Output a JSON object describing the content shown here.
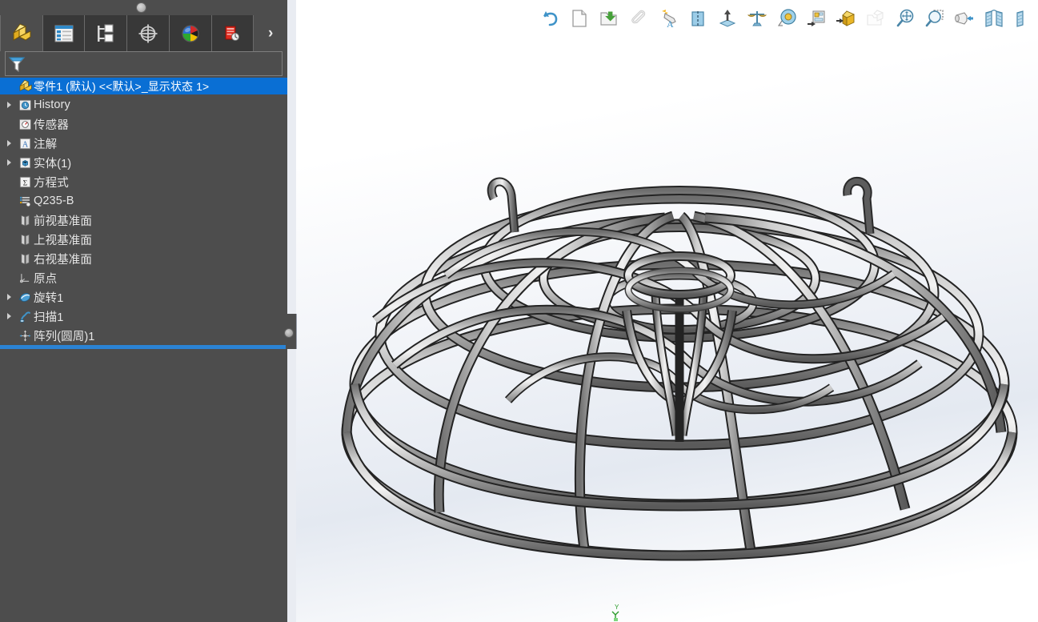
{
  "panel": {
    "grip_name": "panel-splitter-handle",
    "tabs": [
      {
        "id": "feature-manager",
        "label": "FeatureManager 设计树",
        "icon": "yellow-feature-tree-icon",
        "active": true
      },
      {
        "id": "property-manager",
        "label": "PropertyManager",
        "icon": "property-list-icon",
        "active": false
      },
      {
        "id": "configuration-manager",
        "label": "ConfigurationManager",
        "icon": "configuration-tree-icon",
        "active": false
      },
      {
        "id": "dimxpert-manager",
        "label": "DimXpertManager",
        "icon": "dimxpert-target-icon",
        "active": false
      },
      {
        "id": "display-manager",
        "label": "DisplayManager",
        "icon": "display-sphere-icon",
        "active": false
      },
      {
        "id": "appearance-manager",
        "label": "外观",
        "icon": "red-appearance-icon",
        "active": false
      }
    ],
    "expander_glyph": "›",
    "filter": {
      "placeholder": "",
      "value": "",
      "icon": "filter-funnel-icon"
    }
  },
  "tree": {
    "root": {
      "label": "零件1 (默认) <<默认>_显示状态 1>",
      "icon": "part-yellow-icon",
      "selected": true
    },
    "items": [
      {
        "label": "History",
        "icon": "history-icon",
        "expandable": true
      },
      {
        "label": "传感器",
        "icon": "sensor-icon",
        "expandable": false
      },
      {
        "label": "注解",
        "icon": "annotation-icon",
        "expandable": true
      },
      {
        "label": "实体(1)",
        "icon": "solid-body-icon",
        "expandable": true
      },
      {
        "label": "方程式",
        "icon": "equation-icon",
        "expandable": false
      },
      {
        "label": "Q235-B",
        "icon": "material-icon",
        "expandable": false
      },
      {
        "label": "前视基准面",
        "icon": "plane-icon",
        "expandable": false
      },
      {
        "label": "上视基准面",
        "icon": "plane-icon",
        "expandable": false
      },
      {
        "label": "右视基准面",
        "icon": "plane-icon",
        "expandable": false
      },
      {
        "label": "原点",
        "icon": "origin-icon",
        "expandable": false
      },
      {
        "label": "旋转1",
        "icon": "revolve-icon",
        "expandable": true
      },
      {
        "label": "扫描1",
        "icon": "sweep-icon",
        "expandable": true
      },
      {
        "label": "阵列(圆周)1",
        "icon": "circular-pattern-icon",
        "expandable": false
      }
    ],
    "rollback_bar": "rollback-bar"
  },
  "toolbar": {
    "buttons": [
      {
        "id": "undo",
        "label": "撤销",
        "icon": "undo-arrow-icon",
        "enabled": true
      },
      {
        "id": "new-document",
        "label": "新建",
        "icon": "new-document-icon",
        "enabled": true
      },
      {
        "id": "open-document",
        "label": "打开",
        "icon": "open-folder-icon",
        "enabled": true
      },
      {
        "id": "attach",
        "label": "附件",
        "icon": "paperclip-icon",
        "enabled": true
      },
      {
        "id": "appearance",
        "label": "外观/布景",
        "icon": "appearance-spray-icon",
        "enabled": true
      },
      {
        "id": "mirror-plane",
        "label": "基准面显示",
        "icon": "plane-display-icon",
        "enabled": true
      },
      {
        "id": "extrude",
        "label": "拉伸",
        "icon": "extrude-up-icon",
        "enabled": true
      },
      {
        "id": "mass-properties",
        "label": "质量属性",
        "icon": "balance-scale-icon",
        "enabled": true
      },
      {
        "id": "measure",
        "label": "测量",
        "icon": "measure-tape-icon",
        "enabled": true
      },
      {
        "id": "section-props",
        "label": "剖面属性",
        "icon": "section-properties-icon",
        "enabled": true
      },
      {
        "id": "export-part",
        "label": "导出零件",
        "icon": "export-part-icon",
        "enabled": true
      },
      {
        "id": "open-drawing",
        "label": "打开工程图",
        "icon": "open-drawing-icon",
        "enabled": false
      },
      {
        "id": "zoom-to-fit",
        "label": "整屏显示",
        "icon": "zoom-fit-icon",
        "enabled": true
      },
      {
        "id": "zoom-to-area",
        "label": "局部放大",
        "icon": "zoom-area-icon",
        "enabled": true
      },
      {
        "id": "view-orientation",
        "label": "视图定向",
        "icon": "view-orientation-icon",
        "enabled": true
      },
      {
        "id": "section-view",
        "label": "剖面视图",
        "icon": "section-view-icon",
        "enabled": true
      },
      {
        "id": "display-style",
        "label": "显示样式",
        "icon": "display-style-icon",
        "enabled": true
      }
    ]
  },
  "viewport": {
    "axis_indicator": {
      "y_label": "Y",
      "color": "#2a9a2a",
      "name": "triad-axis-indicator"
    },
    "watermark": {
      "name": "hex-cube-watermark",
      "color": "#8fcdf0"
    },
    "model": {
      "name": "dome-wire-frame-model",
      "description": "圆周阵列管状圆顶框架",
      "material_color": "#9a9a9a",
      "edge_color": "#2b2b2b"
    },
    "background_top": "#ffffff",
    "background_mid": "#e4e9f1"
  }
}
